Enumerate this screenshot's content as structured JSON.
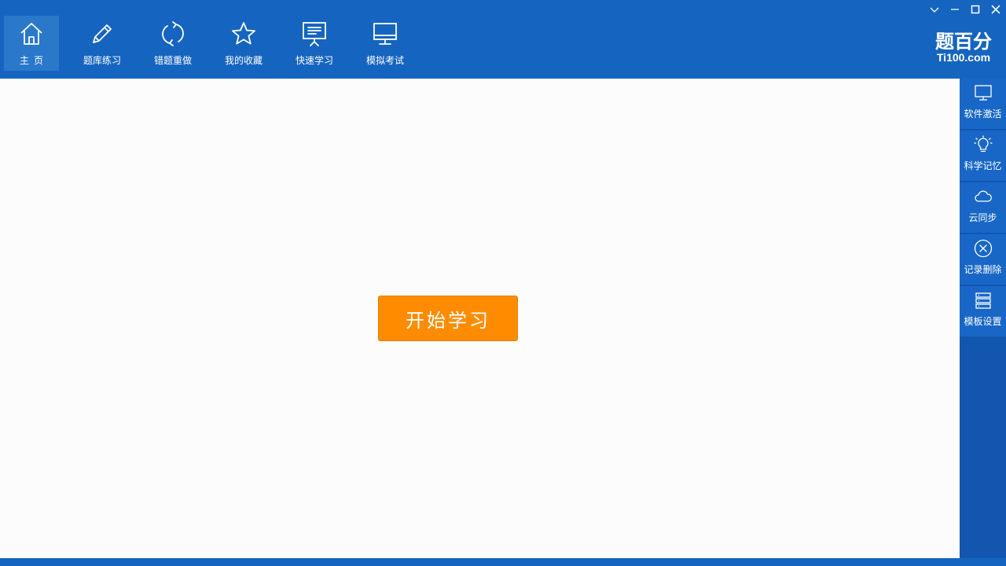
{
  "toolbar": {
    "nav": [
      {
        "label": "主页",
        "icon": "home-icon"
      },
      {
        "label": "题库练习",
        "icon": "pencil-icon"
      },
      {
        "label": "错题重做",
        "icon": "refresh-icon"
      },
      {
        "label": "我的收藏",
        "icon": "star-icon"
      },
      {
        "label": "快速学习",
        "icon": "presentation-board-icon"
      },
      {
        "label": "模拟考试",
        "icon": "monitor-icon"
      }
    ],
    "active_index": 0
  },
  "logo": {
    "cn": "题百分",
    "en": "Ti100.com"
  },
  "sidebar": {
    "items": [
      {
        "label": "软件激活",
        "icon": "monitor-icon"
      },
      {
        "label": "科学记忆",
        "icon": "lightbulb-icon"
      },
      {
        "label": "云同步",
        "icon": "cloud-icon"
      },
      {
        "label": "记录删除",
        "icon": "close-circle-icon"
      },
      {
        "label": "模板设置",
        "icon": "list-settings-icon"
      }
    ]
  },
  "main": {
    "start_button_label": "开始学习"
  },
  "colors": {
    "header_blue": "#1565c0",
    "sidebar_blue": "#1867c7",
    "accent_orange": "#ff8c00"
  }
}
